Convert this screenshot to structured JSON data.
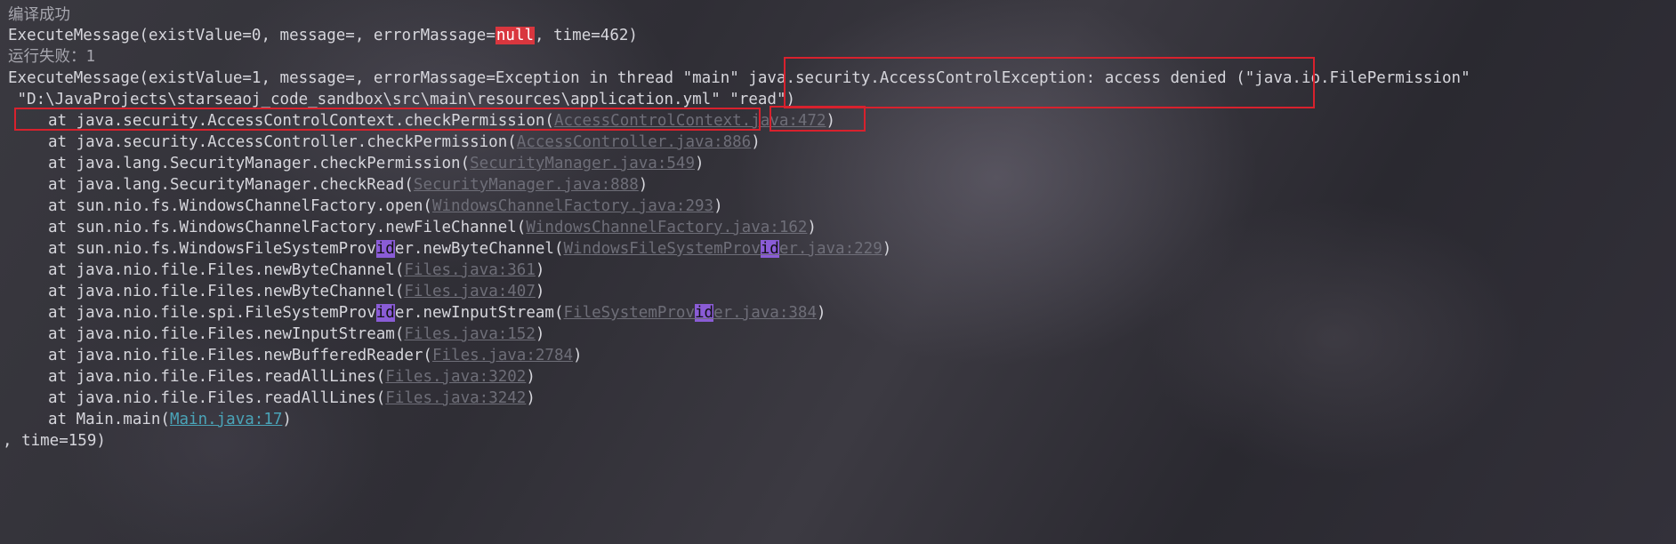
{
  "console": {
    "line1": "编译成功",
    "line2": {
      "a": "ExecuteMessage(existValue=0, message=, errorMassage=",
      "b": "null",
      "c": ", time=462)"
    },
    "line3": "运行失败：1",
    "line4": {
      "a": "ExecuteMessage(existValue=1, message=, errorMassage=Exception in thread \"main\" java.security.AccessControlException: access denied (\"java.io.FilePermission\""
    },
    "line5": {
      "a": " \"D:\\JavaProjects\\starseaoj_code_sandbox\\src\\main\\resources\\application.yml\" \"read\")"
    },
    "stack": [
      {
        "pre": "at java.security.AccessControlContext.checkPermission(",
        "link": "AccessControlContext.java:472",
        "post": ")"
      },
      {
        "pre": "at java.security.AccessController.checkPermission(",
        "link": "AccessController.java:886",
        "post": ")"
      },
      {
        "pre": "at java.lang.SecurityManager.checkPermission(",
        "link": "SecurityManager.java:549",
        "post": ")"
      },
      {
        "pre": "at java.lang.SecurityManager.checkRead(",
        "link": "SecurityManager.java:888",
        "post": ")"
      },
      {
        "pre": "at sun.nio.fs.WindowsChannelFactory.open(",
        "link": "WindowsChannelFactory.java:293",
        "post": ")"
      },
      {
        "pre": "at sun.nio.fs.WindowsChannelFactory.newFileChannel(",
        "link": "WindowsChannelFactory.java:162",
        "post": ")"
      },
      {
        "pre1": "at sun.nio.fs.WindowsFileSystemProv",
        "hl1": "id",
        "pre2": "er.newByteChannel(",
        "link1": "WindowsFileSystemProv",
        "hl2": "id",
        "link2": "er.java:229",
        "post": ")"
      },
      {
        "pre": "at java.nio.file.Files.newByteChannel(",
        "link": "Files.java:361",
        "post": ")"
      },
      {
        "pre": "at java.nio.file.Files.newByteChannel(",
        "link": "Files.java:407",
        "post": ")"
      },
      {
        "pre1": "at java.nio.file.spi.FileSystemProv",
        "hl1": "id",
        "pre2": "er.newInputStream(",
        "link1": "FileSystemProv",
        "hl2": "id",
        "link2": "er.java:384",
        "post": ")"
      },
      {
        "pre": "at java.nio.file.Files.newInputStream(",
        "link": "Files.java:152",
        "post": ")"
      },
      {
        "pre": "at java.nio.file.Files.newBufferedReader(",
        "link": "Files.java:2784",
        "post": ")"
      },
      {
        "pre": "at java.nio.file.Files.readAllLines(",
        "link": "Files.java:3202",
        "post": ")"
      },
      {
        "pre": "at java.nio.file.Files.readAllLines(",
        "link": "Files.java:3242",
        "post": ")"
      },
      {
        "pre": "at Main.main(",
        "link": "Main.java:17",
        "post": ")"
      }
    ],
    "last_line": ", time=159)"
  },
  "colors": {
    "annotation_box": "#d8212d",
    "null_highlight": "#d9363e",
    "search_highlight": "#8a5cd6",
    "link": "#6e6e78",
    "main_link": "#4aa4b8"
  }
}
